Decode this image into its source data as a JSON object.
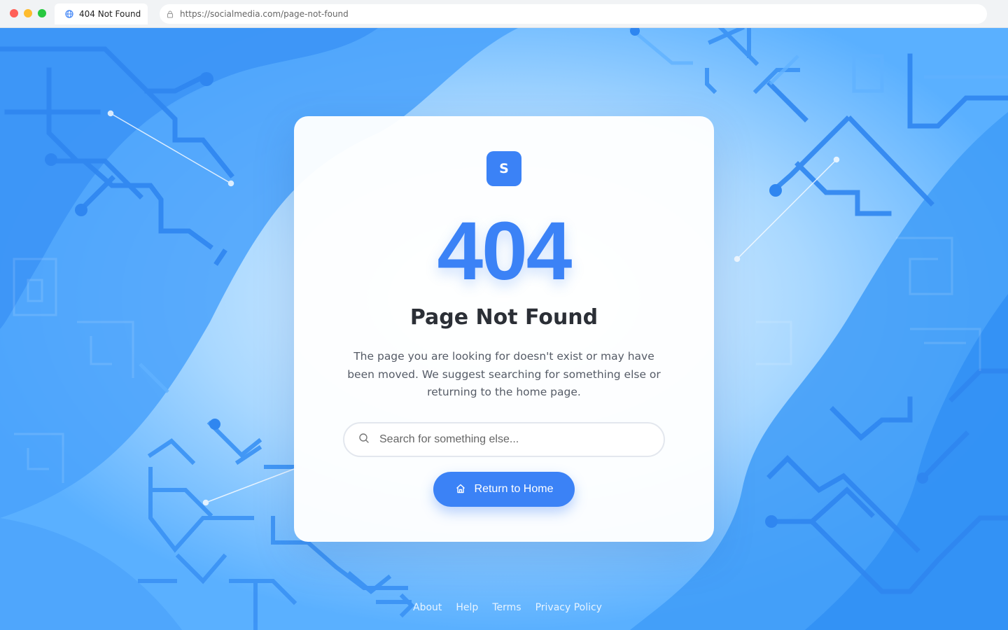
{
  "browser": {
    "tab": {
      "title": "404 Not Found",
      "icon": "globe-icon"
    },
    "url": "https://socialmedia.com/page-not-found",
    "lock_icon": "lock-icon",
    "traffic_lights": [
      "#ff5f57",
      "#febc2e",
      "#28c840"
    ]
  },
  "card": {
    "logo_letter": "S",
    "error_code": "404",
    "heading": "Page Not Found",
    "description": "The page you are looking for doesn't exist or may have been moved. We suggest searching for something else or returning to the home page.",
    "search": {
      "placeholder": "Search for something else...",
      "value": "",
      "icon": "search-icon"
    },
    "home_button": {
      "label": "Return to Home",
      "icon": "home-icon"
    }
  },
  "footer": {
    "links": [
      "About",
      "Help",
      "Terms",
      "Privacy Policy"
    ]
  },
  "colors": {
    "accent": "#3b82f6",
    "background": "#8ecaff",
    "heading": "#2b2f36",
    "body_text": "#555b66"
  }
}
